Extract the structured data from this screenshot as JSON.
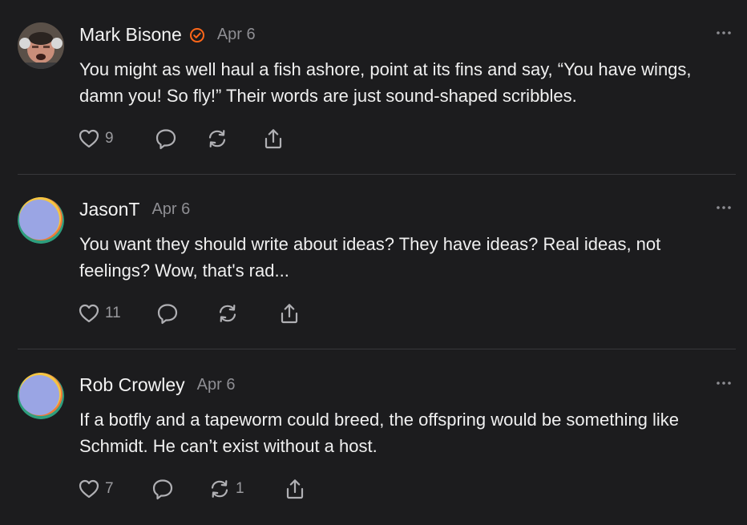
{
  "posts": [
    {
      "author": "Mark Bisone",
      "verified": true,
      "date": "Apr 6",
      "text": "You might as well haul a fish ashore, point at its fins and say, “You have wings, damn you! So fly!” Their words are just sound-shaped scribbles.",
      "likes": "9",
      "restacks": ""
    },
    {
      "author": "JasonT",
      "verified": false,
      "date": "Apr 6",
      "text": "You want they should write about ideas? They have ideas? Real ideas, not feelings? Wow, that's rad...",
      "likes": "11",
      "restacks": ""
    },
    {
      "author": "Rob Crowley",
      "verified": false,
      "date": "Apr 6",
      "text": "If a botfly and a tapeworm could breed, the offspring would be something like Schmidt. He can’t exist without a host.",
      "likes": "7",
      "restacks": "1"
    }
  ],
  "colors": {
    "background": "#1c1c1e",
    "verified": "#ff6719",
    "muted": "#8e8e93",
    "divider": "#38383b"
  },
  "icons": [
    "verified-badge-icon",
    "more-options-icon",
    "heart-icon",
    "comment-icon",
    "restack-icon",
    "share-icon"
  ]
}
